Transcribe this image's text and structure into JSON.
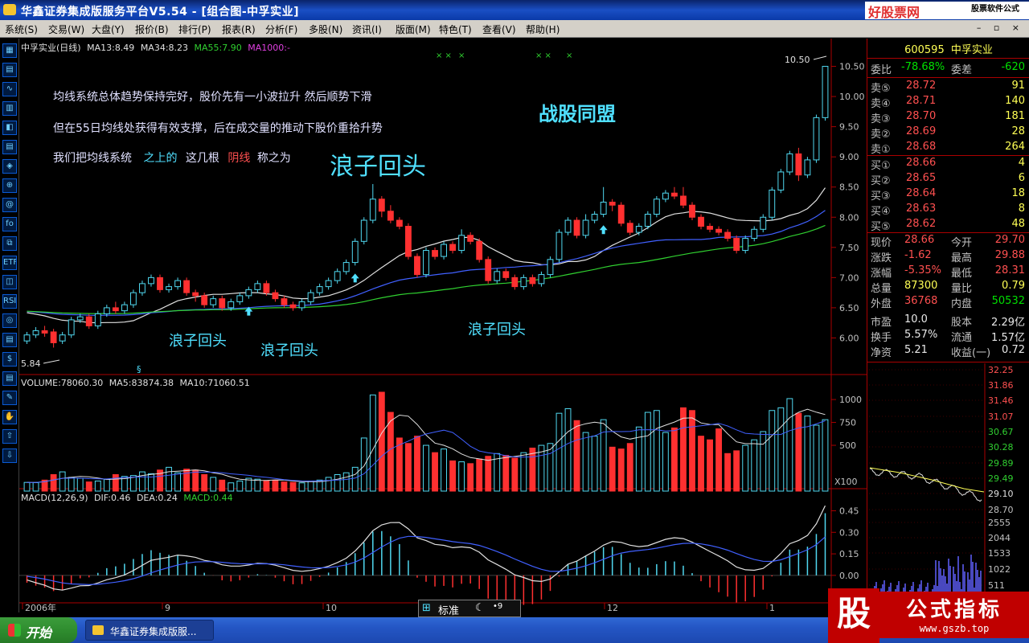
{
  "window": {
    "title": "华鑫证券集成版服务平台V5.54 - [组合图-中孚实业]",
    "brand": "好股票网Goodgupiao.com",
    "brand_sub": "股票软件公式"
  },
  "menu": [
    "系统(S)",
    "交易(W)",
    "大盘(Y)",
    "报价(B)",
    "排行(P)",
    "报表(R)",
    "分析(F)",
    "多股(N)",
    "资讯(I)",
    "版面(M)",
    "特色(T)",
    "查看(V)",
    "帮助(H)"
  ],
  "toolbar_icons": [
    "▦",
    "▤",
    "∿",
    "▥",
    "◧",
    "▤",
    "◈",
    "⊕",
    "@",
    "fo",
    "⧉",
    "ETF",
    "◫",
    "RSI",
    "◎",
    "▤",
    "$",
    "▤",
    "✎",
    "✋",
    "⇧",
    "⇩"
  ],
  "legend_main": {
    "name": "中孚实业(日线)",
    "ma13": "MA13:8.49",
    "ma34": "MA34:8.23",
    "ma55": "MA55:7.90",
    "ma1000": "MA1000:-"
  },
  "legend_volume": {
    "volume": "VOLUME:78060.30",
    "ma5": "MA5:83874.38",
    "ma10": "MA10:71060.51"
  },
  "legend_macd": {
    "name": "MACD(12,26,9)",
    "dif": "DIF:0.46",
    "dea": "DEA:0.24",
    "macd": "MACD:0.44"
  },
  "annotations": {
    "line1": "均线系统总体趋势保持完好，股价先有一小波拉升  然后顺势下滑",
    "line2": "但在55日均线处获得有效支撑，后在成交量的推动下股价重拾升势",
    "line3_a": "我们把均线系统",
    "line3_b": "之上的",
    "line3_c": "这几根",
    "line3_d": "阴线",
    "line3_e": "称之为",
    "big_term": "浪子回头",
    "watermark": "战股同盟",
    "label1": "浪子回头",
    "label2": "浪子回头",
    "label3": "浪子回头",
    "max_price": "10.50",
    "min_price": "5.84",
    "x_marks": [
      "× ×",
      "×",
      "× ×",
      "×"
    ]
  },
  "price_axis": [
    "10.50",
    "10.00",
    "9.50",
    "9.00",
    "8.50",
    "8.00",
    "7.50",
    "7.00",
    "6.50",
    "6.00"
  ],
  "volume_axis": [
    "1000",
    "750",
    "500"
  ],
  "volume_unit": "X100",
  "macd_axis": [
    "0.45",
    "0.30",
    "0.15",
    "0.00"
  ],
  "date_axis": [
    "2006年",
    "9",
    "10",
    "12",
    "1"
  ],
  "quote": {
    "code": "600595",
    "name": "中孚实业",
    "weibi_label": "委比",
    "weibi_value": "-78.68%",
    "weicha_label": "委差",
    "weicha_value": "-620",
    "sells": [
      {
        "label": "卖⑤",
        "price": "28.72",
        "qty": "91"
      },
      {
        "label": "卖④",
        "price": "28.71",
        "qty": "140"
      },
      {
        "label": "卖③",
        "price": "28.70",
        "qty": "181"
      },
      {
        "label": "卖②",
        "price": "28.69",
        "qty": "28"
      },
      {
        "label": "卖①",
        "price": "28.68",
        "qty": "264"
      }
    ],
    "buys": [
      {
        "label": "买①",
        "price": "28.66",
        "qty": "4"
      },
      {
        "label": "买②",
        "price": "28.65",
        "qty": "6"
      },
      {
        "label": "买③",
        "price": "28.64",
        "qty": "18"
      },
      {
        "label": "买④",
        "price": "28.63",
        "qty": "8"
      },
      {
        "label": "买⑤",
        "price": "28.62",
        "qty": "48"
      }
    ],
    "stats": [
      {
        "l1": "现价",
        "v1": "28.66",
        "l2": "今开",
        "v2": "29.70",
        "c1": "red",
        "c2": "red"
      },
      {
        "l1": "涨跌",
        "v1": "-1.62",
        "l2": "最高",
        "v2": "29.88",
        "c1": "red",
        "c2": "red"
      },
      {
        "l1": "涨幅",
        "v1": "-5.35%",
        "l2": "最低",
        "v2": "28.31",
        "c1": "red",
        "c2": "red"
      },
      {
        "l1": "总量",
        "v1": "87300",
        "l2": "量比",
        "v2": "0.79",
        "c1": "yellow",
        "c2": "yellow"
      },
      {
        "l1": "外盘",
        "v1": "36768",
        "l2": "内盘",
        "v2": "50532",
        "c1": "red",
        "c2": "green"
      },
      {
        "l1": "市盈",
        "v1": "10.0",
        "l2": "股本",
        "v2": "2.29亿",
        "c1": "white",
        "c2": "white"
      },
      {
        "l1": "换手",
        "v1": "5.57%",
        "l2": "流通",
        "v2": "1.57亿",
        "c1": "white",
        "c2": "white"
      },
      {
        "l1": "净资",
        "v1": "5.21",
        "l2": "收益(一)",
        "v2": "0.72",
        "c1": "white",
        "c2": "white"
      }
    ],
    "mini_axis": [
      "32.25",
      "31.86",
      "31.46",
      "31.07",
      "30.67",
      "30.28",
      "29.89",
      "29.49",
      "29.10",
      "28.70",
      "2555",
      "2044",
      "1533",
      "1022",
      "511"
    ]
  },
  "std_bar": {
    "label": "标准"
  },
  "taskbar": {
    "start": "开始",
    "app": "华鑫证券集成版服..."
  },
  "corner_watermark": {
    "char": "股",
    "title": "公式指标",
    "url": "www.gszb.top"
  },
  "colors": {
    "up": "#ff3030",
    "down": "#50d8f0",
    "ma13": "#e0e0e0",
    "ma34": "#4060ff",
    "ma55": "#30d030"
  },
  "chart_data": {
    "type": "candlestick",
    "candles": [
      [
        5.95,
        6.05,
        6.1,
        5.9
      ],
      [
        6.05,
        6.12,
        6.18,
        6.0
      ],
      [
        6.12,
        6.08,
        6.2,
        6.02
      ],
      [
        6.1,
        5.92,
        6.15,
        5.84
      ],
      [
        5.95,
        6.05,
        6.1,
        5.9
      ],
      [
        6.05,
        6.3,
        6.35,
        6.0
      ],
      [
        6.3,
        6.35,
        6.4,
        6.25
      ],
      [
        6.35,
        6.2,
        6.4,
        6.15
      ],
      [
        6.2,
        6.4,
        6.45,
        6.15
      ],
      [
        6.4,
        6.5,
        6.55,
        6.35
      ],
      [
        6.5,
        6.45,
        6.6,
        6.4
      ],
      [
        6.45,
        6.55,
        6.6,
        6.4
      ],
      [
        6.55,
        6.75,
        6.8,
        6.5
      ],
      [
        6.75,
        6.9,
        6.95,
        6.7
      ],
      [
        6.9,
        7.0,
        7.05,
        6.85
      ],
      [
        7.0,
        6.8,
        7.05,
        6.75
      ],
      [
        6.8,
        6.85,
        6.9,
        6.75
      ],
      [
        6.85,
        6.95,
        7.0,
        6.8
      ],
      [
        6.95,
        6.75,
        7.0,
        6.7
      ],
      [
        6.75,
        6.7,
        6.8,
        6.6
      ],
      [
        6.7,
        6.55,
        6.75,
        6.5
      ],
      [
        6.55,
        6.65,
        6.7,
        6.5
      ],
      [
        6.65,
        6.5,
        6.7,
        6.45
      ],
      [
        6.5,
        6.6,
        6.65,
        6.45
      ],
      [
        6.6,
        6.7,
        6.75,
        6.55
      ],
      [
        6.7,
        6.8,
        6.85,
        6.65
      ],
      [
        6.8,
        6.9,
        6.95,
        6.75
      ],
      [
        6.9,
        6.75,
        6.95,
        6.7
      ],
      [
        6.75,
        6.65,
        6.8,
        6.6
      ],
      [
        6.65,
        6.55,
        6.7,
        6.5
      ],
      [
        6.55,
        6.5,
        6.6,
        6.45
      ],
      [
        6.5,
        6.6,
        6.65,
        6.45
      ],
      [
        6.6,
        6.75,
        6.8,
        6.55
      ],
      [
        6.75,
        6.85,
        6.9,
        6.7
      ],
      [
        6.85,
        6.95,
        7.0,
        6.8
      ],
      [
        6.95,
        7.1,
        7.15,
        6.9
      ],
      [
        7.1,
        7.25,
        7.3,
        7.05
      ],
      [
        7.25,
        7.6,
        7.65,
        7.2
      ],
      [
        7.6,
        7.95,
        8.0,
        7.55
      ],
      [
        7.95,
        8.3,
        8.55,
        7.9
      ],
      [
        8.3,
        8.1,
        8.35,
        8.0
      ],
      [
        8.1,
        7.95,
        8.2,
        7.9
      ],
      [
        7.95,
        7.85,
        8.0,
        7.8
      ],
      [
        7.85,
        7.35,
        7.9,
        7.3
      ],
      [
        7.35,
        7.05,
        7.4,
        7.0
      ],
      [
        7.05,
        7.45,
        7.5,
        7.0
      ],
      [
        7.45,
        7.35,
        7.5,
        7.3
      ],
      [
        7.35,
        7.55,
        7.6,
        7.3
      ],
      [
        7.55,
        7.45,
        7.6,
        7.4
      ],
      [
        7.45,
        7.7,
        7.8,
        7.4
      ],
      [
        7.7,
        7.6,
        7.75,
        7.55
      ],
      [
        7.6,
        7.3,
        7.65,
        7.25
      ],
      [
        7.3,
        6.95,
        7.35,
        6.9
      ],
      [
        6.95,
        7.1,
        7.15,
        6.9
      ],
      [
        7.1,
        7.0,
        7.15,
        6.95
      ],
      [
        7.0,
        6.85,
        7.05,
        6.8
      ],
      [
        6.85,
        7.0,
        7.05,
        6.8
      ],
      [
        7.0,
        6.9,
        7.05,
        6.85
      ],
      [
        6.9,
        7.05,
        7.1,
        6.85
      ],
      [
        7.05,
        7.3,
        7.35,
        7.0
      ],
      [
        7.3,
        7.75,
        7.8,
        7.25
      ],
      [
        7.75,
        7.95,
        8.0,
        7.7
      ],
      [
        7.95,
        7.7,
        8.0,
        7.65
      ],
      [
        7.7,
        7.95,
        8.05,
        7.65
      ],
      [
        7.95,
        8.05,
        8.1,
        7.9
      ],
      [
        8.05,
        8.25,
        8.5,
        8.0
      ],
      [
        8.25,
        8.2,
        8.3,
        8.1
      ],
      [
        8.2,
        7.9,
        8.25,
        7.85
      ],
      [
        7.9,
        7.75,
        7.95,
        7.7
      ],
      [
        7.75,
        7.85,
        7.9,
        7.7
      ],
      [
        7.85,
        8.05,
        8.1,
        7.8
      ],
      [
        8.05,
        8.3,
        8.35,
        8.0
      ],
      [
        8.3,
        8.4,
        8.45,
        8.25
      ],
      [
        8.4,
        8.35,
        8.5,
        8.3
      ],
      [
        8.35,
        8.2,
        8.5,
        8.15
      ],
      [
        8.2,
        8.0,
        8.25,
        7.95
      ],
      [
        8.0,
        7.85,
        8.05,
        7.8
      ],
      [
        7.85,
        7.8,
        7.9,
        7.75
      ],
      [
        7.8,
        7.75,
        7.85,
        7.7
      ],
      [
        7.75,
        7.65,
        7.8,
        7.6
      ],
      [
        7.65,
        7.45,
        7.7,
        7.4
      ],
      [
        7.45,
        7.65,
        7.7,
        7.4
      ],
      [
        7.65,
        7.8,
        7.85,
        7.6
      ],
      [
        7.8,
        8.0,
        8.05,
        7.75
      ],
      [
        8.0,
        8.45,
        8.5,
        7.95
      ],
      [
        8.45,
        8.75,
        8.8,
        8.4
      ],
      [
        8.75,
        9.05,
        9.1,
        8.7
      ],
      [
        9.05,
        8.7,
        9.15,
        8.6
      ],
      [
        8.7,
        8.95,
        9.0,
        8.65
      ],
      [
        8.95,
        9.65,
        9.7,
        8.9
      ],
      [
        9.65,
        10.5,
        10.5,
        9.6
      ]
    ],
    "volume": [
      95,
      92,
      120,
      180,
      210,
      150,
      140,
      100,
      110,
      130,
      180,
      160,
      170,
      210,
      190,
      230,
      260,
      200,
      240,
      230,
      180,
      150,
      120,
      90,
      110,
      140,
      130,
      110,
      120,
      100,
      95,
      90,
      110,
      120,
      150,
      180,
      200,
      260,
      580,
      1050,
      1080,
      860,
      580,
      520,
      600,
      500,
      420,
      460,
      330,
      320,
      300,
      350,
      380,
      410,
      390,
      360,
      420,
      470,
      500,
      520,
      850,
      900,
      770,
      640,
      600,
      780,
      480,
      460,
      520,
      700,
      860,
      880,
      640,
      690,
      910,
      880,
      600,
      560,
      680,
      410,
      440,
      500,
      560,
      650,
      880,
      910,
      1010,
      850,
      820,
      720,
      780
    ],
    "price_range": [
      5.5,
      10.8
    ]
  }
}
